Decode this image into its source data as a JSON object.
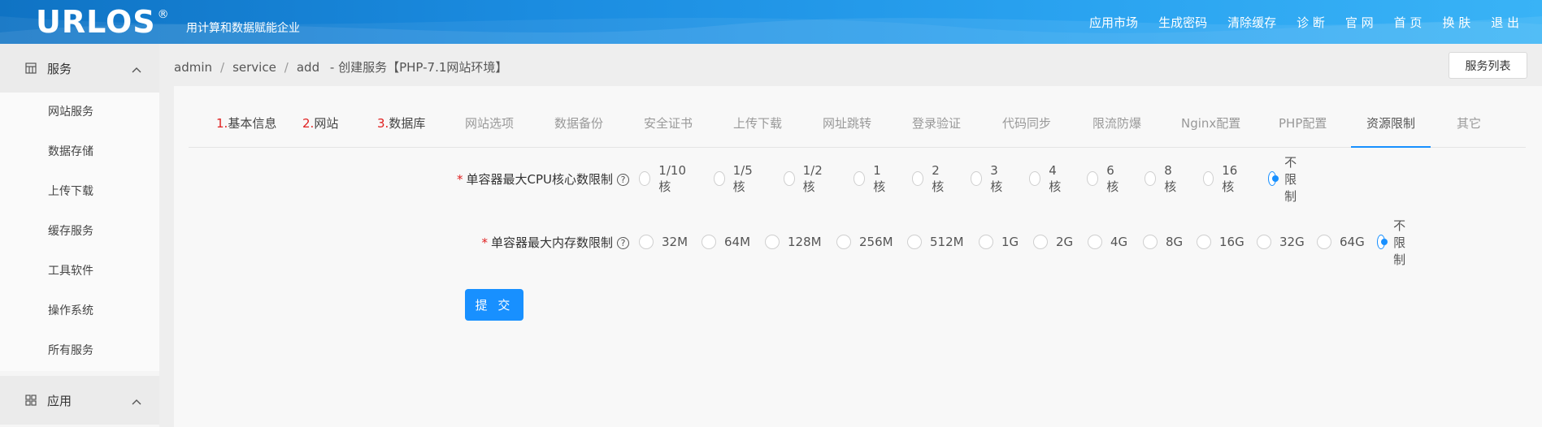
{
  "header": {
    "logo": "URLOS",
    "logo_mark": "®",
    "tagline": "用计算和数据赋能企业",
    "nav": [
      "应用市场",
      "生成密码",
      "清除缓存",
      "诊 断",
      "官 网",
      "首 页",
      "换 肤",
      "退 出"
    ],
    "colors": {
      "from": "#0f73c4",
      "to": "#39b3f6"
    }
  },
  "sidebar": {
    "group1": {
      "label": "服务",
      "icon": "server-icon"
    },
    "items": [
      "网站服务",
      "数据存储",
      "上传下载",
      "缓存服务",
      "工具软件",
      "操作系统",
      "所有服务"
    ],
    "group2": {
      "label": "应用",
      "icon": "apps-grid-icon"
    }
  },
  "breadcrumb": {
    "parts": [
      "admin",
      "service",
      "add"
    ],
    "title": "-  创建服务【PHP-7.1网站环境】"
  },
  "list_button": "服务列表",
  "tabs": [
    {
      "num": "1.",
      "label": "基本信息"
    },
    {
      "num": "2.",
      "label": "网站"
    },
    {
      "num": "3.",
      "label": "数据库"
    },
    {
      "label": "网站选项"
    },
    {
      "label": "数据备份"
    },
    {
      "label": "安全证书"
    },
    {
      "label": "上传下载"
    },
    {
      "label": "网址跳转"
    },
    {
      "label": "登录验证"
    },
    {
      "label": "代码同步"
    },
    {
      "label": "限流防爆"
    },
    {
      "label": "Nginx配置"
    },
    {
      "label": "PHP配置"
    },
    {
      "label": "资源限制"
    },
    {
      "label": "其它"
    }
  ],
  "active_tab": "资源限制",
  "cpu": {
    "required_mark": "*",
    "label": "单容器最大CPU核心数限制",
    "help": "?",
    "options": [
      "1/10核",
      "1/5核",
      "1/2核",
      "1核",
      "2核",
      "3核",
      "4核",
      "6核",
      "8核",
      "16核",
      "不限制"
    ],
    "selected": "不限制"
  },
  "memory": {
    "required_mark": "*",
    "label": "单容器最大内存数限制",
    "help": "?",
    "options": [
      "32M",
      "64M",
      "128M",
      "256M",
      "512M",
      "1G",
      "2G",
      "4G",
      "8G",
      "16G",
      "32G",
      "64G",
      "不限制"
    ],
    "selected": "不限制"
  },
  "submit_label": "提 交",
  "accent_color": "#1890ff"
}
